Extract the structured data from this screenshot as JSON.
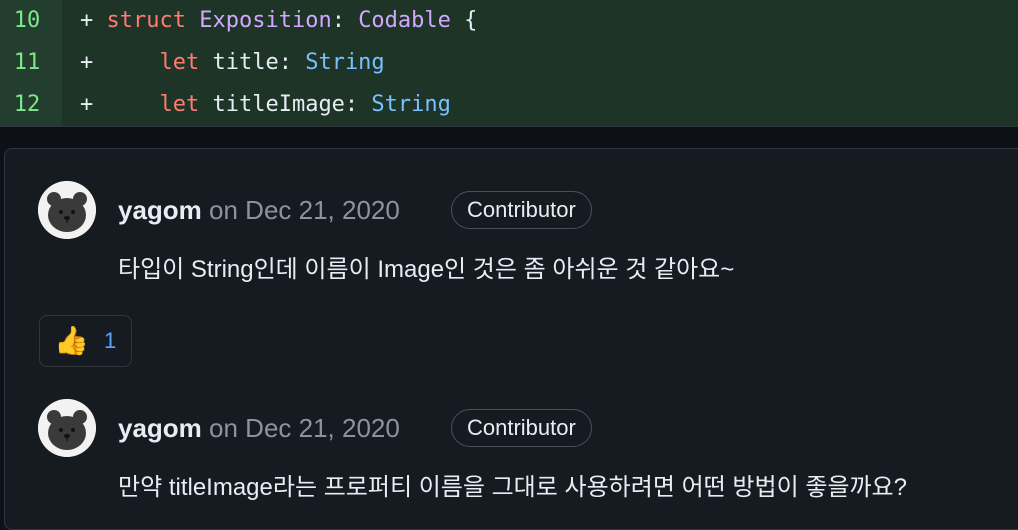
{
  "diff": {
    "lines": [
      {
        "number": "10",
        "marker": "+",
        "tokens": [
          {
            "t": "struct",
            "c": "kw"
          },
          {
            "t": " ",
            "c": "id"
          },
          {
            "t": "Exposition",
            "c": "type"
          },
          {
            "t": ": ",
            "c": "id"
          },
          {
            "t": "Codable",
            "c": "type"
          },
          {
            "t": " {",
            "c": "id"
          }
        ]
      },
      {
        "number": "11",
        "marker": "+",
        "tokens": [
          {
            "t": "    ",
            "c": "id"
          },
          {
            "t": "let",
            "c": "kw"
          },
          {
            "t": " title: ",
            "c": "id"
          },
          {
            "t": "String",
            "c": "str"
          }
        ]
      },
      {
        "number": "12",
        "marker": "+",
        "tokens": [
          {
            "t": "    ",
            "c": "id"
          },
          {
            "t": "let",
            "c": "kw"
          },
          {
            "t": " titleImage: ",
            "c": "id"
          },
          {
            "t": "String",
            "c": "str"
          }
        ]
      }
    ]
  },
  "comments": [
    {
      "author": "yagom",
      "date_text": " on Dec 21, 2020",
      "badge": "Contributor",
      "body": "타입이 String인데 이름이 Image인 것은 좀 아쉬운 것 같아요~",
      "reaction": {
        "emoji": "👍",
        "count": "1"
      }
    },
    {
      "author": "yagom",
      "date_text": " on Dec 21, 2020",
      "badge": "Contributor",
      "body": "만약 titleImage라는 프로퍼티 이름을 그대로 사용하려면 어떤 방법이 좋을까요?"
    }
  ],
  "colors": {
    "diff_bg": "#1d3427",
    "line_number": "#7ee787",
    "keyword": "#ff7b72",
    "type": "#d2a8ff",
    "string_type": "#79c0ff",
    "reaction_count": "#58a6ff"
  },
  "icons": {
    "avatar": "bear-avatar-icon",
    "reaction": "thumbs-up-icon"
  }
}
